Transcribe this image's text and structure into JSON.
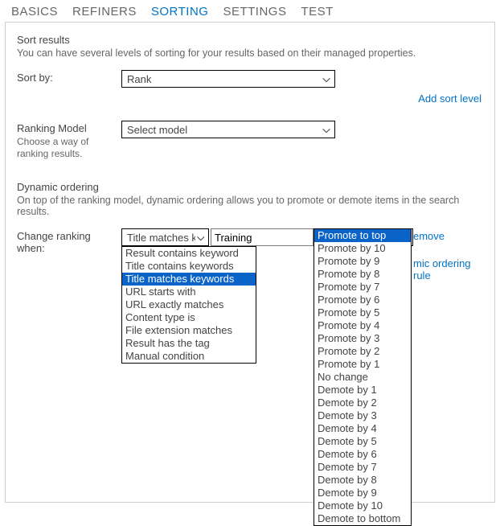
{
  "tabs": {
    "basics": "BASICS",
    "refiners": "REFINERS",
    "sorting": "SORTING",
    "settings": "SETTINGS",
    "test": "TEST"
  },
  "sortResults": {
    "title": "Sort results",
    "desc": "You can have several levels of sorting for your results based on their managed properties.",
    "sortByLabel": "Sort by:",
    "sortByValue": "Rank",
    "addSortLevel": "Add sort level"
  },
  "rankingModel": {
    "label": "Ranking Model",
    "sub": "Choose a way of ranking results.",
    "value": "Select model"
  },
  "dynamicOrdering": {
    "title": "Dynamic ordering",
    "desc": "On top of the ranking model, dynamic ordering allows you to promote or demote items in the search results.",
    "label": "Change ranking when:",
    "conditionValue": "Title matches ke",
    "textValue": "Training",
    "actionValue": "Promote to top",
    "removeLink": "emove",
    "addRuleLink": "mic ordering rule"
  },
  "conditionOptions": [
    "Result contains keyword",
    "Title contains keywords",
    "Title matches keywords",
    "URL starts with",
    "URL exactly matches",
    "Content type is",
    "File extension matches",
    "Result has the tag",
    "Manual condition"
  ],
  "conditionSelectedIndex": 2,
  "actionOptions": [
    "Promote to top",
    "Promote by 10",
    "Promote by 9",
    "Promote by 8",
    "Promote by 7",
    "Promote by 6",
    "Promote by 5",
    "Promote by 4",
    "Promote by 3",
    "Promote by 2",
    "Promote by 1",
    "No change",
    "Demote by 1",
    "Demote by 2",
    "Demote by 3",
    "Demote by 4",
    "Demote by 5",
    "Demote by 6",
    "Demote by 7",
    "Demote by 8",
    "Demote by 9",
    "Demote by 10",
    "Demote to bottom"
  ],
  "actionSelectedIndex": 0
}
